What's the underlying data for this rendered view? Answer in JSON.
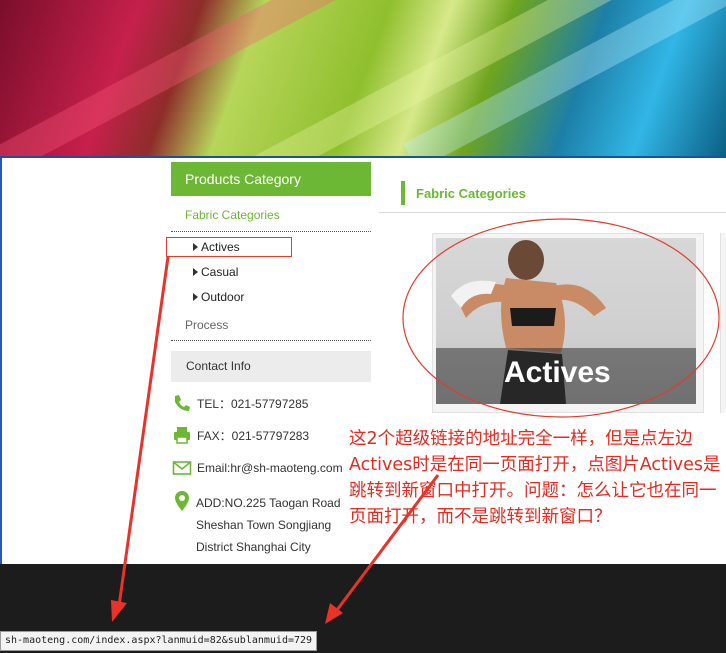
{
  "banner": {
    "icon": "fabric-banner-image"
  },
  "sidebar": {
    "category_header": "Products Category",
    "fabric_link": "Fabric Categories",
    "items": [
      {
        "label": "Actives"
      },
      {
        "label": "Casual"
      },
      {
        "label": "Outdoor"
      }
    ],
    "process_link": "Process",
    "contact_header": "Contact Info",
    "tel": "TEL：021-57797285",
    "fax": "FAX：021-57797283",
    "email": "Email:hr@sh-maoteng.com",
    "address": [
      "ADD:NO.225 Taogan Road",
      "Sheshan Town Songjiang",
      "District Shanghai City"
    ]
  },
  "main": {
    "section_title": "Fabric Categories",
    "product": {
      "caption": "Actives"
    }
  },
  "annotation": {
    "text": "这2个超级链接的地址完全一样，但是点左边Actives时是在同一页面打开，点图片Actives是跳转到新窗口中打开。问题：怎么让它也在同一页面打开，而不是跳转到新窗口？",
    "color": "#e52a1f"
  },
  "status_bar": {
    "url": "sh-maoteng.com/index.aspx?lanmuid=82&sublanmuid=729"
  },
  "colors": {
    "accent_green": "#6cb834",
    "footer": "#1c1c1c"
  }
}
